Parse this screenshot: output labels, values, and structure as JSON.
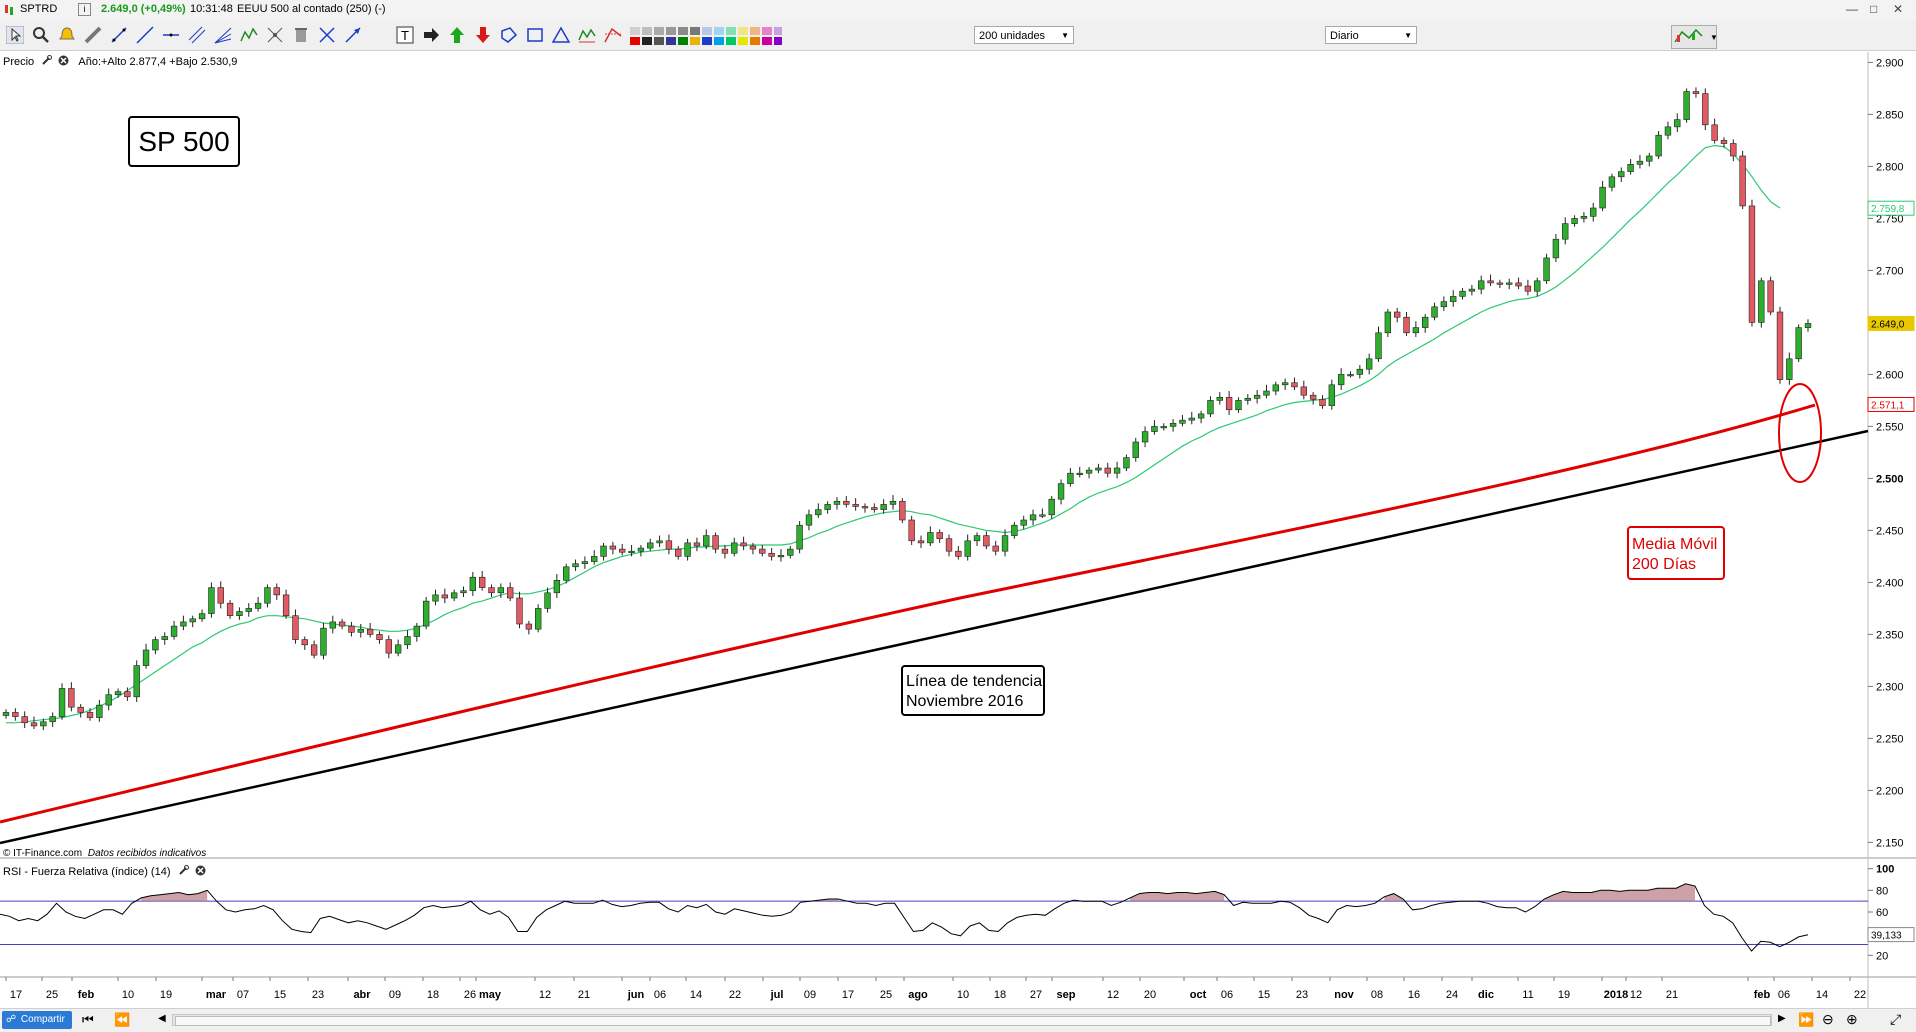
{
  "header": {
    "symbol": "SPTRD",
    "info_icon": "info-icon",
    "last_change": "2.649,0 (+0,49%)",
    "time": "10:31:48",
    "description": "EEUU 500 al contado (250) (-)"
  },
  "toolbar": {
    "units_select": "200 unidades",
    "period_select": "Diario"
  },
  "price_panel": {
    "label": "Precio",
    "range_text": "Año:+Alto 2.877,4 +Bajo 2.530,9",
    "credit": "© IT-Finance.com",
    "credit_note": "Datos recibidos indicativos"
  },
  "rsi_panel": {
    "label": "RSI - Fuerza Relativa (índice) (14)"
  },
  "bottom": {
    "share_button": "Compartir"
  },
  "colors": {
    "up_candle": "#2eae2e",
    "down_candle": "#e25a64",
    "ma_short": "#2ec872",
    "ma_200": "#e00000",
    "trendline": "#000000",
    "rsi_line": "#000000",
    "rsi_levels": "#4040c8",
    "rsi_fill": "#b87a82"
  },
  "chart_data": {
    "type": "candlestick",
    "title": "SP 500",
    "annotations": [
      "SP 500",
      "Línea de tendencia\nNoviembre 2016",
      "Media Móvil\n200 Días"
    ],
    "price_axis": {
      "ticks": [
        "2.150",
        "2.200",
        "2.250",
        "2.300",
        "2.350",
        "2.400",
        "2.450",
        "2.500",
        "2.550",
        "2.600",
        "2.650",
        "2.700",
        "2.750",
        "2.800",
        "2.850",
        "2.900"
      ],
      "tick_values": [
        2150,
        2200,
        2250,
        2300,
        2350,
        2400,
        2450,
        2500,
        2550,
        2600,
        2650,
        2700,
        2750,
        2800,
        2850,
        2900
      ],
      "bold_ticks": [
        "2.500"
      ],
      "ylim": [
        2135,
        2910
      ],
      "labels": [
        {
          "text": "2.759,8",
          "value": 2759.8,
          "color": "#2ec872",
          "filled": false
        },
        {
          "text": "2.649,0",
          "value": 2649.0,
          "color": "#e8c800",
          "filled": true
        },
        {
          "text": "2.571,1",
          "value": 2571.1,
          "color": "#e00000",
          "filled": false
        }
      ]
    },
    "rsi_axis": {
      "ticks": [
        "20",
        "40",
        "60",
        "80",
        "100"
      ],
      "tick_values": [
        20,
        40,
        60,
        80,
        100
      ],
      "bold_ticks": [
        "100"
      ],
      "levels": [
        70,
        30
      ],
      "ylim": [
        0,
        108
      ],
      "current_label": "39,133",
      "current_value": 39.133
    },
    "x_axis": {
      "ticks": [
        {
          "text": "17",
          "bold": false
        },
        {
          "text": "25",
          "bold": false
        },
        {
          "text": "feb",
          "bold": true
        },
        {
          "text": "10",
          "bold": false
        },
        {
          "text": "19",
          "bold": false
        },
        {
          "text": "mar",
          "bold": true
        },
        {
          "text": "07",
          "bold": false
        },
        {
          "text": "15",
          "bold": false
        },
        {
          "text": "23",
          "bold": false
        },
        {
          "text": "abr",
          "bold": true
        },
        {
          "text": "09",
          "bold": false
        },
        {
          "text": "18",
          "bold": false
        },
        {
          "text": "26",
          "bold": false
        },
        {
          "text": "may",
          "bold": true
        },
        {
          "text": "12",
          "bold": false
        },
        {
          "text": "21",
          "bold": false
        },
        {
          "text": "jun",
          "bold": true
        },
        {
          "text": "06",
          "bold": false
        },
        {
          "text": "14",
          "bold": false
        },
        {
          "text": "22",
          "bold": false
        },
        {
          "text": "jul",
          "bold": true
        },
        {
          "text": "09",
          "bold": false
        },
        {
          "text": "17",
          "bold": false
        },
        {
          "text": "25",
          "bold": false
        },
        {
          "text": "ago",
          "bold": true
        },
        {
          "text": "10",
          "bold": false
        },
        {
          "text": "18",
          "bold": false
        },
        {
          "text": "27",
          "bold": false
        },
        {
          "text": "sep",
          "bold": true
        },
        {
          "text": "12",
          "bold": false
        },
        {
          "text": "20",
          "bold": false
        },
        {
          "text": "oct",
          "bold": true
        },
        {
          "text": "06",
          "bold": false
        },
        {
          "text": "15",
          "bold": false
        },
        {
          "text": "23",
          "bold": false
        },
        {
          "text": "nov",
          "bold": true
        },
        {
          "text": "08",
          "bold": false
        },
        {
          "text": "16",
          "bold": false
        },
        {
          "text": "24",
          "bold": false
        },
        {
          "text": "dic",
          "bold": true
        },
        {
          "text": "11",
          "bold": false
        },
        {
          "text": "19",
          "bold": false
        },
        {
          "text": "2018",
          "bold": true
        },
        {
          "text": "12",
          "bold": false
        },
        {
          "text": "21",
          "bold": false
        },
        {
          "text": "feb",
          "bold": true
        },
        {
          "text": "06",
          "bold": false
        },
        {
          "text": "14",
          "bold": false
        },
        {
          "text": "22",
          "bold": false
        }
      ]
    },
    "close_series": [
      2275,
      2271,
      2265,
      2262,
      2266,
      2271,
      2298,
      2280,
      2275,
      2270,
      2282,
      2292,
      2295,
      2290,
      2320,
      2335,
      2345,
      2348,
      2358,
      2362,
      2365,
      2370,
      2395,
      2380,
      2368,
      2372,
      2375,
      2380,
      2395,
      2388,
      2368,
      2345,
      2340,
      2330,
      2356,
      2362,
      2358,
      2352,
      2355,
      2350,
      2345,
      2332,
      2340,
      2348,
      2358,
      2382,
      2388,
      2385,
      2390,
      2392,
      2405,
      2395,
      2390,
      2395,
      2385,
      2360,
      2355,
      2375,
      2390,
      2402,
      2415,
      2418,
      2420,
      2425,
      2435,
      2432,
      2429,
      2430,
      2433,
      2438,
      2440,
      2432,
      2425,
      2438,
      2435,
      2445,
      2432,
      2428,
      2438,
      2435,
      2432,
      2428,
      2425,
      2426,
      2432,
      2455,
      2465,
      2470,
      2475,
      2478,
      2475,
      2473,
      2472,
      2470,
      2475,
      2478,
      2460,
      2440,
      2438,
      2448,
      2442,
      2430,
      2425,
      2440,
      2445,
      2435,
      2430,
      2445,
      2455,
      2460,
      2465,
      2465,
      2480,
      2495,
      2505,
      2505,
      2508,
      2510,
      2505,
      2510,
      2520,
      2535,
      2545,
      2550,
      2550,
      2553,
      2556,
      2558,
      2562,
      2575,
      2578,
      2566,
      2575,
      2577,
      2580,
      2584,
      2590,
      2592,
      2588,
      2580,
      2576,
      2570,
      2590,
      2600,
      2600,
      2605,
      2615,
      2640,
      2660,
      2655,
      2640,
      2645,
      2655,
      2665,
      2670,
      2675,
      2680,
      2682,
      2690,
      2688,
      2687,
      2688,
      2685,
      2680,
      2690,
      2712,
      2730,
      2745,
      2750,
      2752,
      2760,
      2780,
      2790,
      2795,
      2802,
      2805,
      2810,
      2830,
      2838,
      2845,
      2872,
      2870,
      2840,
      2825,
      2822,
      2810,
      2762,
      2650,
      2690,
      2660,
      2595,
      2615,
      2645,
      2649
    ],
    "ma_short_series": [
      2265,
      2265,
      2266,
      2267,
      2268,
      2269,
      2270,
      2272,
      2274,
      2277,
      2281,
      2285,
      2290,
      2296,
      2302,
      2308,
      2314,
      2320,
      2326,
      2332,
      2338,
      2342,
      2348,
      2353,
      2357,
      2360,
      2362,
      2366,
      2368,
      2368,
      2367,
      2366,
      2365,
      2363,
      2361,
      2360,
      2359,
      2358,
      2357,
      2355,
      2354,
      2353,
      2353,
      2354,
      2356,
      2360,
      2364,
      2369,
      2373,
      2376,
      2380,
      2382,
      2385,
      2388,
      2390,
      2389,
      2389,
      2391,
      2393,
      2396,
      2400,
      2405,
      2410,
      2415,
      2419,
      2422,
      2425,
      2427,
      2429,
      2430,
      2431,
      2432,
      2432,
      2433,
      2434,
      2434,
      2435,
      2435,
      2436,
      2436,
      2436,
      2436,
      2436,
      2436,
      2437,
      2440,
      2443,
      2447,
      2450,
      2454,
      2457,
      2460,
      2463,
      2465,
      2467,
      2468,
      2469,
      2468,
      2466,
      2465,
      2462,
      2459,
      2456,
      2454,
      2452,
      2450,
      2449,
      2448,
      2449,
      2451,
      2454,
      2457,
      2461,
      2466,
      2471,
      2477,
      2482,
      2486,
      2489,
      2492,
      2496,
      2501,
      2507,
      2513,
      2519,
      2525,
      2531,
      2536,
      2540,
      2545,
      2549,
      2552,
      2555,
      2558,
      2561,
      2565,
      2568,
      2571,
      2573,
      2574,
      2575,
      2576,
      2578,
      2581,
      2585,
      2589,
      2594,
      2600,
      2608,
      2614,
      2619,
      2624,
      2629,
      2634,
      2640,
      2645,
      2650,
      2655,
      2660,
      2664,
      2667,
      2670,
      2672,
      2673,
      2675,
      2679,
      2684,
      2691,
      2698,
      2706,
      2714,
      2722,
      2731,
      2740,
      2749,
      2757,
      2766,
      2775,
      2784,
      2792,
      2801,
      2810,
      2818,
      2820,
      2819,
      2812,
      2802,
      2790,
      2777,
      2766,
      2760
    ],
    "rsi_series": [
      58,
      56,
      52,
      54,
      52,
      58,
      68,
      60,
      56,
      54,
      58,
      62,
      62,
      58,
      68,
      73,
      75,
      76,
      77,
      78,
      76,
      77,
      80,
      70,
      62,
      60,
      62,
      63,
      66,
      62,
      52,
      44,
      42,
      41,
      54,
      56,
      53,
      50,
      52,
      50,
      47,
      44,
      48,
      52,
      57,
      64,
      66,
      64,
      65,
      66,
      70,
      62,
      58,
      61,
      55,
      42,
      42,
      55,
      62,
      66,
      70,
      68,
      68,
      68,
      71,
      67,
      65,
      66,
      68,
      69,
      69,
      63,
      60,
      66,
      64,
      67,
      60,
      58,
      63,
      61,
      59,
      57,
      56,
      57,
      60,
      69,
      70,
      71,
      72,
      72,
      70,
      68,
      68,
      66,
      68,
      68,
      55,
      42,
      43,
      50,
      46,
      40,
      38,
      47,
      50,
      43,
      42,
      50,
      55,
      57,
      58,
      57,
      63,
      68,
      71,
      70,
      70,
      70,
      66,
      69,
      73,
      77,
      78,
      78,
      77,
      78,
      78,
      77,
      78,
      79,
      76,
      66,
      69,
      68,
      68,
      68,
      70,
      69,
      64,
      57,
      54,
      50,
      62,
      66,
      65,
      66,
      68,
      74,
      77,
      72,
      62,
      63,
      66,
      68,
      69,
      70,
      70,
      70,
      68,
      65,
      64,
      64,
      60,
      65,
      72,
      76,
      79,
      78,
      78,
      78,
      80,
      80,
      79,
      80,
      80,
      80,
      82,
      82,
      82,
      86,
      84,
      66,
      58,
      56,
      50,
      36,
      24,
      33,
      32,
      28,
      32,
      37,
      39
    ]
  }
}
